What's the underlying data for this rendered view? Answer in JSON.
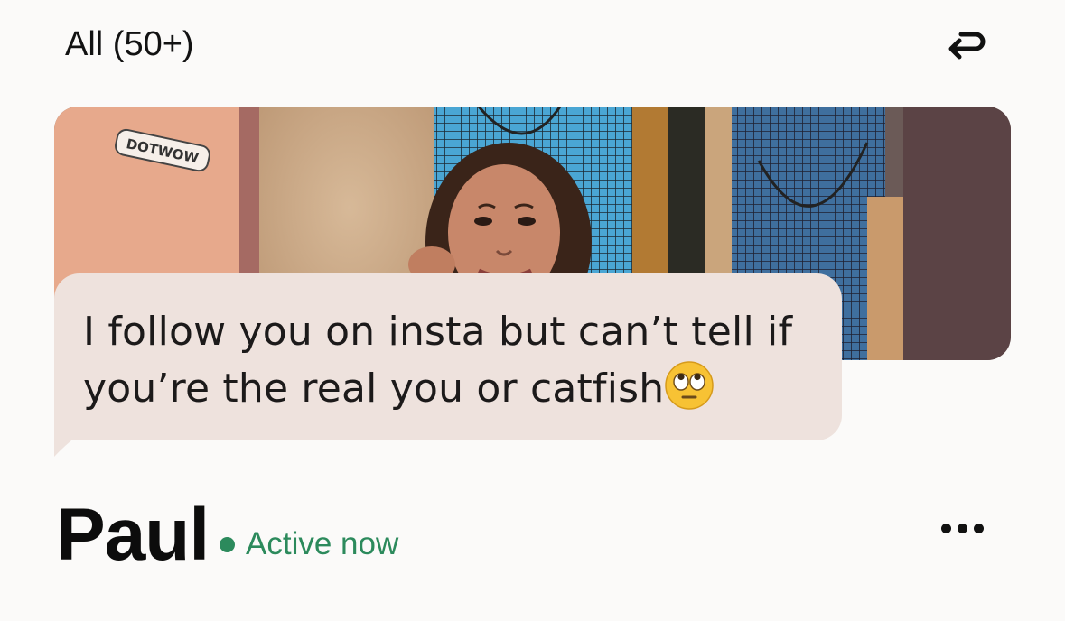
{
  "header": {
    "title": "All (50+)",
    "undo_icon": "undo-arrow-icon"
  },
  "message": {
    "text": "I follow you on insta but can’t tell if you’re the real you or catfish",
    "emoji": "face-with-rolling-eyes"
  },
  "profile": {
    "name": "Paul",
    "status": "Active now",
    "more_icon": "more-dots-icon"
  },
  "photo": {
    "sticker_text": "DOTWOW"
  },
  "colors": {
    "background": "#fbfaf9",
    "bubble": "#eee2dd",
    "active_green": "#2c8a5c",
    "text": "#111111"
  }
}
